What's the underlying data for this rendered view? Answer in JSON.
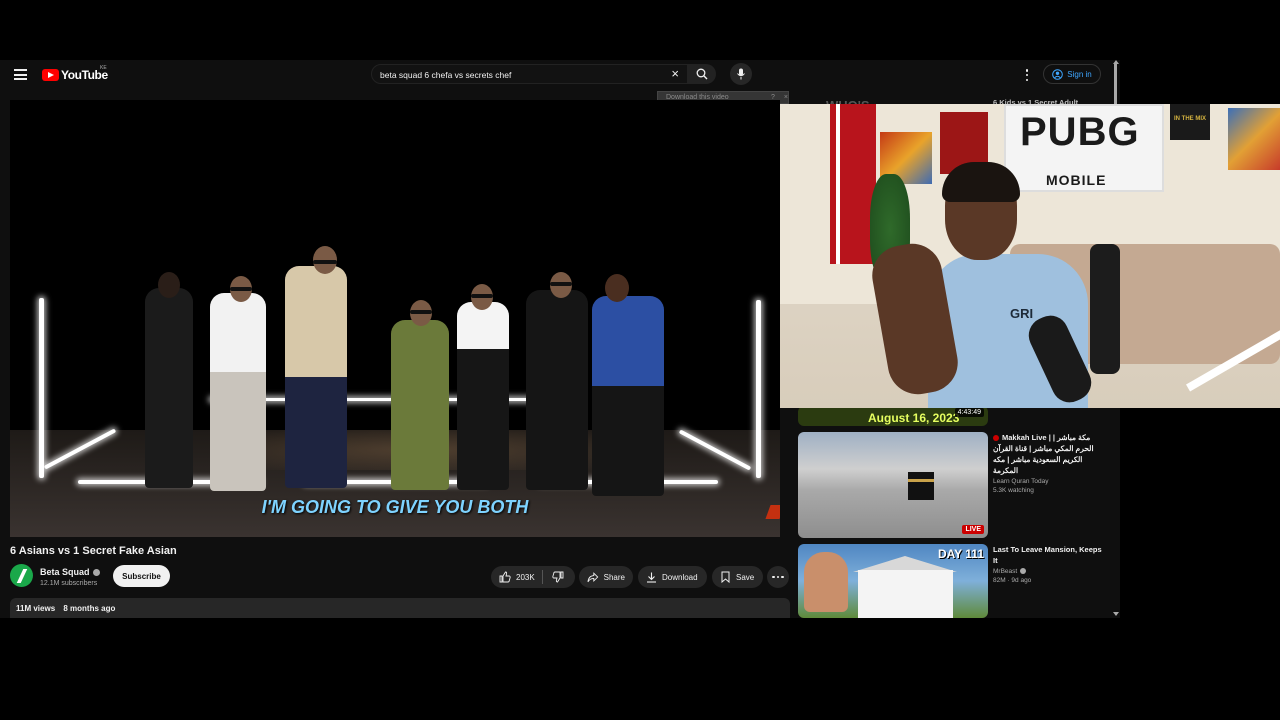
{
  "header": {
    "logo_text": "YouTube",
    "country_code": "KE",
    "search_value": "beta squad 6 chefa vs secrets chef",
    "sign_in_label": "Sign in"
  },
  "download_overlay": {
    "label": "Download this video",
    "help": "?",
    "close": "×"
  },
  "video": {
    "caption": "I'M GOING TO GIVE YOU BOTH",
    "title": "6 Asians vs 1 Secret Fake Asian",
    "channel_name": "Beta Squad",
    "subscribers": "12.1M subscribers",
    "subscribe_label": "Subscribe",
    "likes": "203K",
    "share_label": "Share",
    "download_label": "Download",
    "save_label": "Save",
    "views": "11M views",
    "age": "8 months ago"
  },
  "sidebar": {
    "partial_title": "6 Kids vs 1 Secret Adult",
    "partial_thumb_text": "August 16, 2023",
    "partial_duration": "4:43:49",
    "items": [
      {
        "title": "Makkah Live | | مكة مباشر الحرم المكي مباشر | قناة القرآن الكريم السعودية مباشر | مكه المكرمة",
        "channel": "Learn Quran Today",
        "meta": "5.3K watching",
        "badge": "LIVE"
      },
      {
        "title": "Last To Leave Mansion, Keeps It",
        "channel": "MrBeast",
        "meta": "82M · 9d ago",
        "badge": "DAY 111"
      }
    ]
  },
  "webcam": {
    "sign_main": "PUBG",
    "sign_sub": "MOBILE",
    "shirt_text": "GRI",
    "poster_text": "IN THE MIX"
  },
  "colors": {
    "background": "#0f0f0f",
    "accent_red": "#ff0000",
    "link_blue": "#3ea6ff",
    "caption_blue": "#7ed3ff"
  }
}
